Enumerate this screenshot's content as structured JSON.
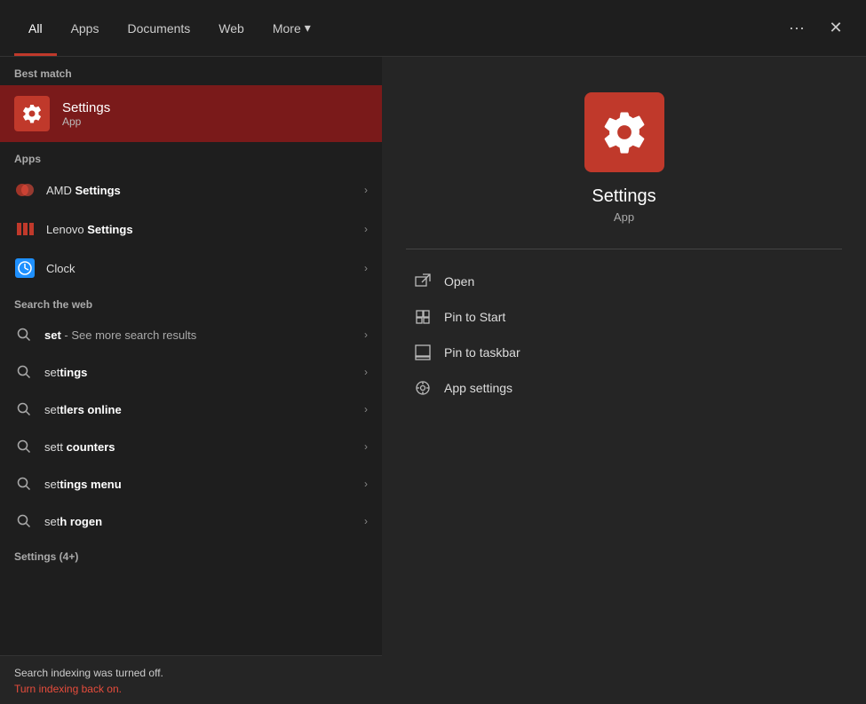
{
  "nav": {
    "tabs": [
      {
        "id": "all",
        "label": "All",
        "active": true
      },
      {
        "id": "apps",
        "label": "Apps",
        "active": false
      },
      {
        "id": "documents",
        "label": "Documents",
        "active": false
      },
      {
        "id": "web",
        "label": "Web",
        "active": false
      },
      {
        "id": "more",
        "label": "More",
        "active": false
      }
    ],
    "more_chevron": "▾",
    "ellipsis": "···",
    "close": "✕"
  },
  "best_match": {
    "section_label": "Best match",
    "title": "Settings",
    "subtitle": "App"
  },
  "apps_section": {
    "label": "Apps",
    "items": [
      {
        "name_prefix": "AMD ",
        "name_bold": "Settings",
        "has_arrow": true
      },
      {
        "name_prefix": "Lenovo ",
        "name_bold": "Settings",
        "has_arrow": true
      },
      {
        "name_prefix": "Clock",
        "name_bold": "",
        "has_arrow": true
      }
    ]
  },
  "web_section": {
    "label": "Search the web",
    "items": [
      {
        "query_normal": "set",
        "query_suffix": " - See more search results",
        "has_arrow": true
      },
      {
        "query_normal": "set",
        "query_bold": "tings",
        "has_arrow": true
      },
      {
        "query_normal": "set",
        "query_bold": "tlers online",
        "has_arrow": true
      },
      {
        "query_normal": "sett",
        "query_bold": " counters",
        "has_arrow": true
      },
      {
        "query_normal": "set",
        "query_bold": "tings menu",
        "has_arrow": true
      },
      {
        "query_normal": "set",
        "query_bold": "h rogen",
        "has_arrow": true
      }
    ]
  },
  "group_label": "Settings (4+)",
  "bottom_bar": {
    "message": "Search indexing was turned off.",
    "link": "Turn indexing back on."
  },
  "right_panel": {
    "title": "Settings",
    "subtitle": "App",
    "actions": [
      {
        "label": "Open"
      },
      {
        "label": "Pin to Start"
      },
      {
        "label": "Pin to taskbar"
      },
      {
        "label": "App settings"
      }
    ]
  }
}
